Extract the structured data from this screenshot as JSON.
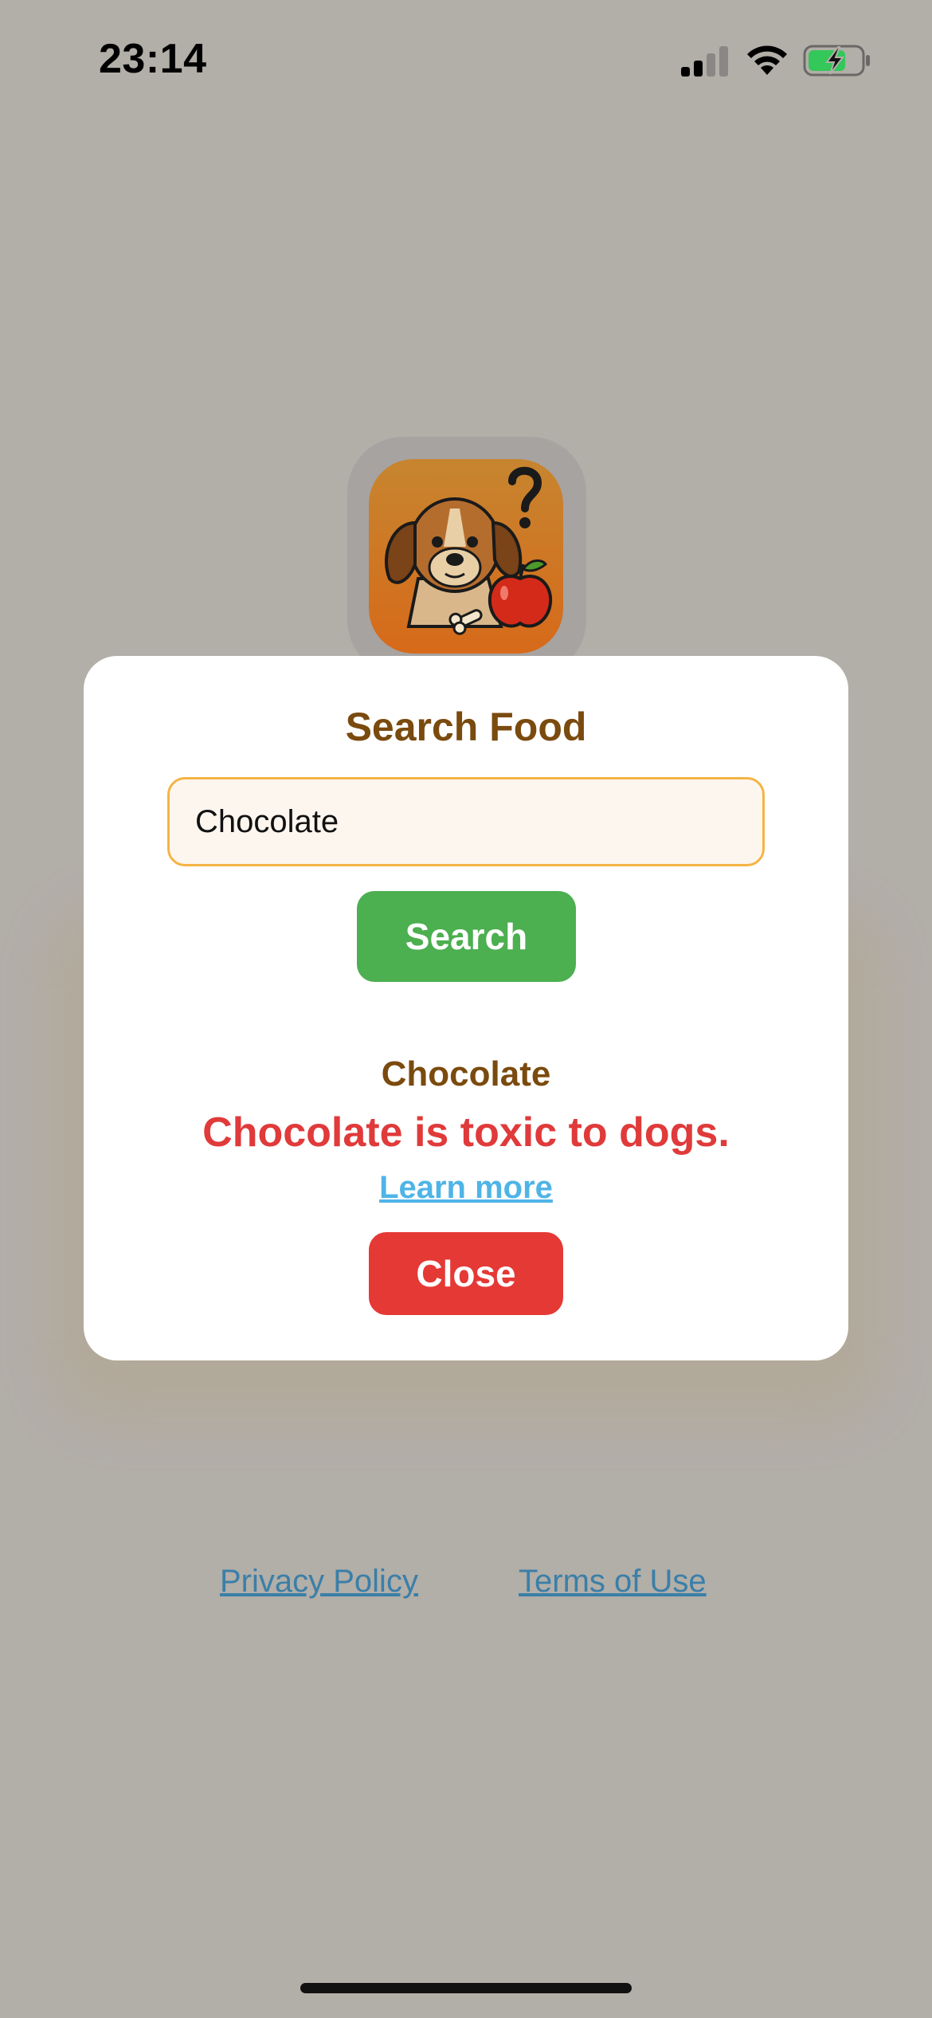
{
  "status_bar": {
    "time": "23:14",
    "signal_icon": "cellular-signal-icon",
    "wifi_icon": "wifi-icon",
    "battery_icon": "battery-charging-icon"
  },
  "app_icon": {
    "icon": "dog-with-apple-question-icon"
  },
  "modal": {
    "title": "Search Food",
    "search_input": {
      "value": "Chocolate",
      "placeholder": ""
    },
    "search_button_label": "Search",
    "result": {
      "food_name": "Chocolate",
      "message": "Chocolate is toxic to dogs.",
      "learn_more_label": "Learn more"
    },
    "close_button_label": "Close"
  },
  "footer": {
    "privacy_label": "Privacy Policy",
    "terms_label": "Terms of Use"
  },
  "colors": {
    "overlay_background": "#b2aea8",
    "title_brown": "#7a4a0e",
    "search_green": "#4caf50",
    "warning_red": "#e03a3a",
    "close_red": "#e53935",
    "link_blue": "#4fb4e6",
    "input_border": "#f5b444"
  }
}
